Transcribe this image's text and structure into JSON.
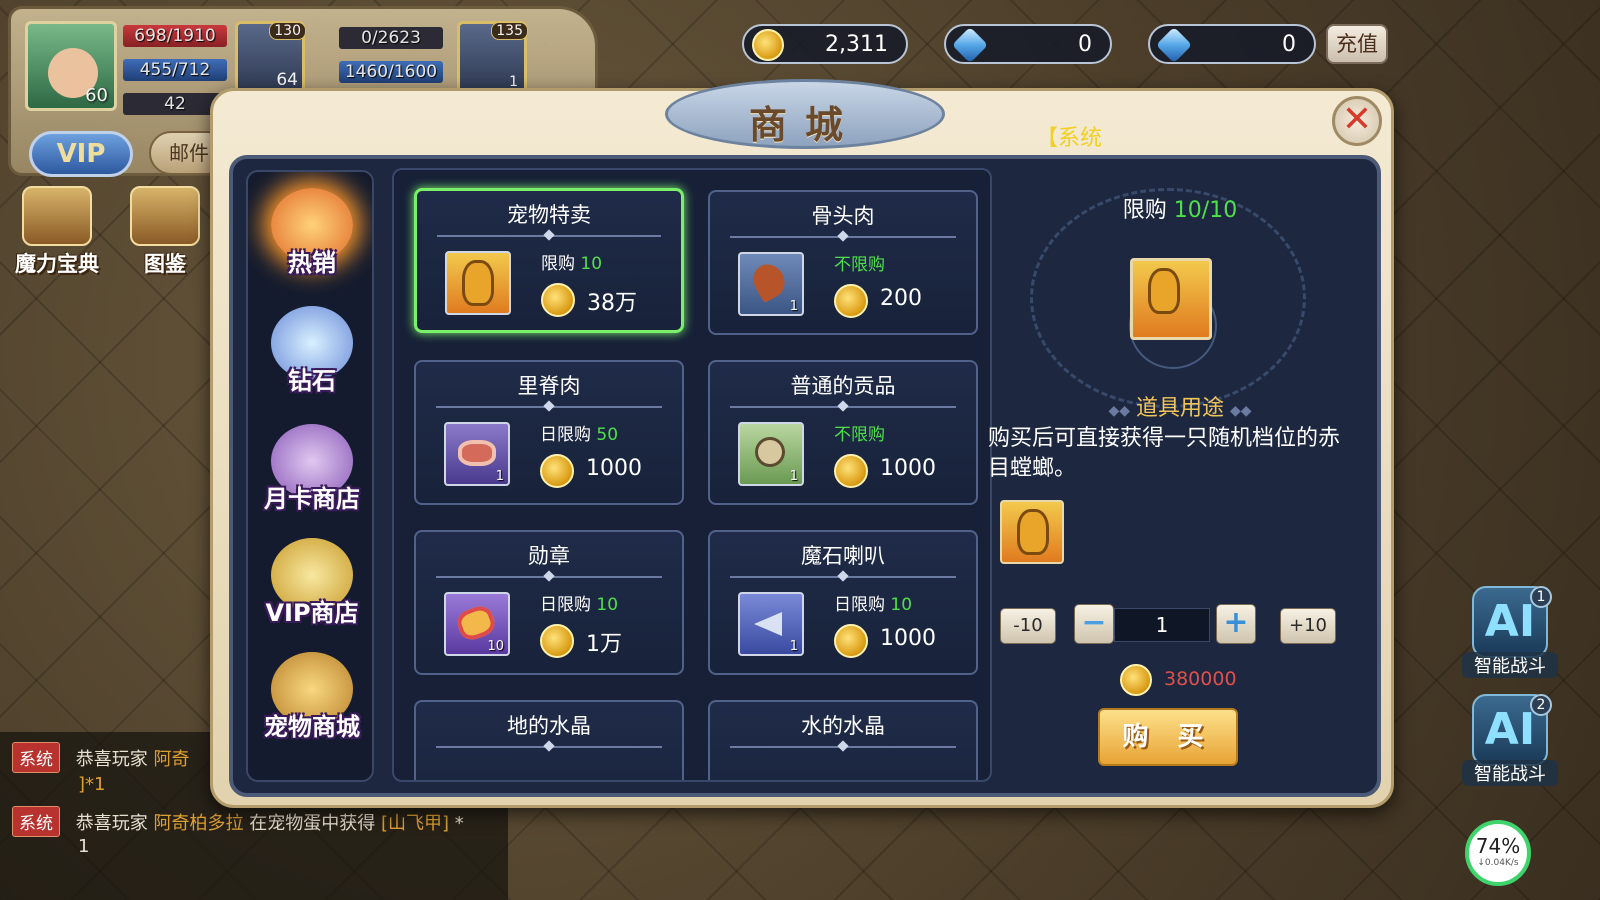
{
  "hud": {
    "player_level": "60",
    "hp": "698/1910",
    "mp": "455/712",
    "energy": "42",
    "pet1_level": "130",
    "pet1_sub": "64",
    "pet_exp": "0/2623",
    "pet_hp": "1460/1600",
    "pet2_level": "135",
    "pet2_count": "1",
    "vip_label": "VIP",
    "mail_label": "邮件",
    "magic_book_label": "魔力宝典",
    "atlas_label": "图鉴"
  },
  "currency": {
    "gold": "2,311",
    "locked_diamond": "0",
    "diamond": "0",
    "recharge_label": "充值"
  },
  "shop": {
    "title": "商城",
    "system_overlay": "【系统",
    "close_label": "✕",
    "categories": [
      {
        "label": "热销"
      },
      {
        "label": "钻石"
      },
      {
        "label": "月卡商店"
      },
      {
        "label": "VIP商店"
      },
      {
        "label": "宠物商城"
      }
    ],
    "items": [
      {
        "name": "宠物特卖",
        "limit_prefix": "限购",
        "limit_value": "10",
        "price": "38万",
        "qty": ""
      },
      {
        "name": "骨头肉",
        "limit_prefix": "",
        "limit_value": "不限购",
        "price": "200",
        "qty": "1"
      },
      {
        "name": "里脊肉",
        "limit_prefix": "日限购",
        "limit_value": "50",
        "price": "1000",
        "qty": "1"
      },
      {
        "name": "普通的贡品",
        "limit_prefix": "",
        "limit_value": "不限购",
        "price": "1000",
        "qty": "1"
      },
      {
        "name": "勋章",
        "limit_prefix": "日限购",
        "limit_value": "10",
        "price": "1万",
        "qty": "10"
      },
      {
        "name": "魔石喇叭",
        "limit_prefix": "日限购",
        "limit_value": "10",
        "price": "1000",
        "qty": "1"
      },
      {
        "name": "地的水晶"
      },
      {
        "name": "水的水晶"
      }
    ],
    "detail": {
      "limit_prefix": "限购",
      "limit_value": "10/10",
      "usage_title": "道具用途",
      "usage_desc": "购买后可直接获得一只随机档位的赤目螳螂。",
      "minus10": "-10",
      "plus10": "+10",
      "quantity": "1",
      "total": "380000",
      "buy_label": "购 买"
    }
  },
  "ai": {
    "button1_label": "智能战斗",
    "button1_num": "1",
    "button2_label": "智能战斗",
    "button2_num": "2",
    "logo": "AI",
    "net_percent": "74%",
    "net_speed": "↓0.04K/s"
  },
  "chat": {
    "tag": "系统",
    "line1_prefix": "恭喜玩家",
    "line1_player": "阿奇",
    "line1_suffix": "]*1",
    "line2_prefix": "恭喜玩家",
    "line2_player": "阿奇柏多拉",
    "line2_mid": "在宠物蛋中获得",
    "line2_item": "[山飞甲]",
    "line2_suffix": "*",
    "line2_count": "1"
  }
}
